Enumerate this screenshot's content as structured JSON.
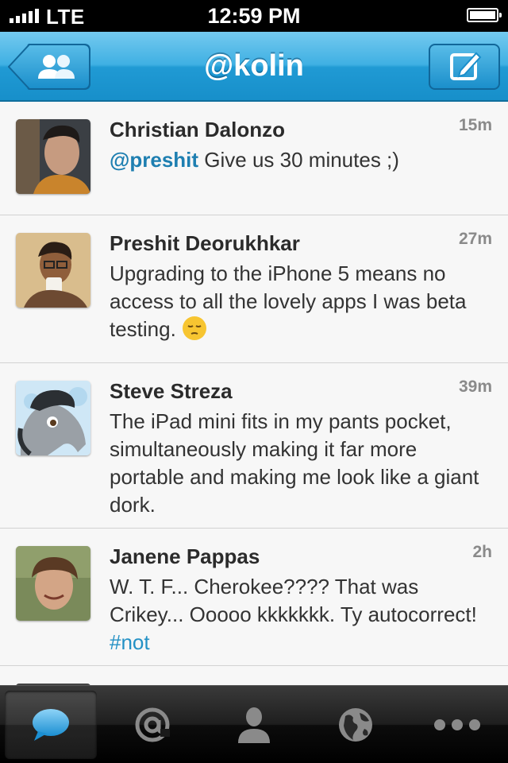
{
  "status_bar": {
    "carrier": "LTE",
    "time": "12:59 PM"
  },
  "nav": {
    "title": "@kolin",
    "back_icon": "people-icon",
    "compose_icon": "compose-icon"
  },
  "tweets": [
    {
      "name": "Christian Dalonzo",
      "time": "15m",
      "mention": "@preshit",
      "text": " Give us 30 minutes ;)"
    },
    {
      "name": "Preshit Deorukhkar",
      "time": "27m",
      "text": "Upgrading to the iPhone 5 means no access to all the lovely apps I was beta testing. ",
      "emoji": "pensive-face-emoji"
    },
    {
      "name": "Steve Streza",
      "time": "39m",
      "text": "The iPad mini fits in my pants pocket, simultaneously making it far more portable and making me look like a giant dork."
    },
    {
      "name": "Janene Pappas",
      "time": "2h",
      "text": "W. T. F... Cherokee???? That was Crikey... Ooooo kkkkkkk. Ty autocorrect! ",
      "hashtag": "#not"
    }
  ],
  "tab_bar": {
    "active": "timeline",
    "tabs": [
      "timeline-bubble-icon",
      "mentions-at-icon",
      "profile-icon",
      "search-globe-icon",
      "more-dots-icon"
    ]
  },
  "colors": {
    "nav_blue": "#2aa2db",
    "link": "#1e7fb1",
    "hashtag": "#2491c5"
  }
}
